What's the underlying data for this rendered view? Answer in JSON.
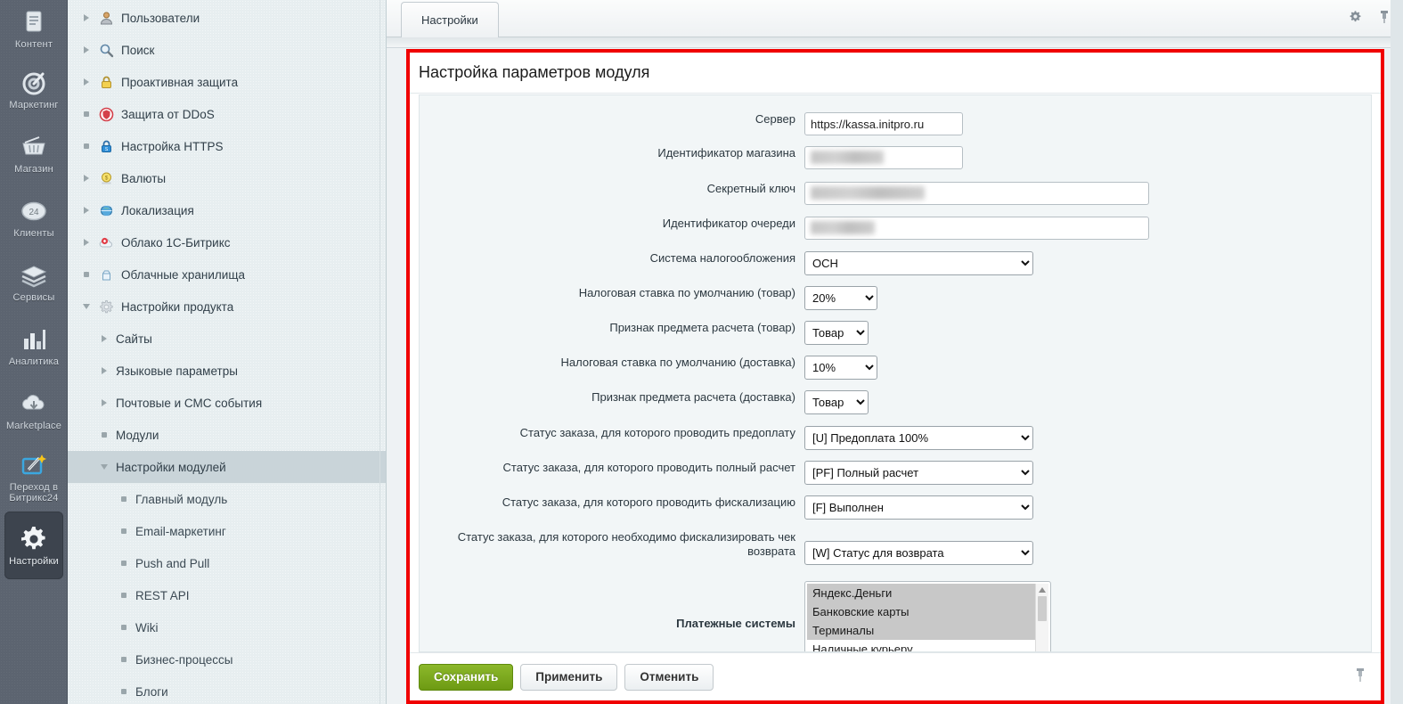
{
  "left_nav": {
    "items": [
      {
        "label": "Контент",
        "icon": "document-icon",
        "active": false
      },
      {
        "label": "Маркетинг",
        "icon": "target-icon",
        "active": false
      },
      {
        "label": "Магазин",
        "icon": "basket-icon",
        "active": false
      },
      {
        "label": "Клиенты",
        "icon": "badge-24-icon",
        "active": false
      },
      {
        "label": "Сервисы",
        "icon": "layers-icon",
        "active": false
      },
      {
        "label": "Аналитика",
        "icon": "bar-chart-icon",
        "active": false
      },
      {
        "label": "Marketplace",
        "icon": "cloud-download-icon",
        "active": false
      },
      {
        "label": "Переход в Битрикс24",
        "icon": "magic-wand-icon",
        "active": false
      },
      {
        "label": "Настройки",
        "icon": "gear-icon",
        "active": true
      }
    ]
  },
  "tree": {
    "items": [
      {
        "label": "Пользователи",
        "twisty": "right",
        "icon": "user-icon",
        "level": 1,
        "selected": false
      },
      {
        "label": "Поиск",
        "twisty": "right",
        "icon": "search-icon",
        "level": 1,
        "selected": false
      },
      {
        "label": "Проактивная защита",
        "twisty": "right",
        "icon": "lock-icon",
        "level": 1,
        "selected": false
      },
      {
        "label": "Защита от DDoS",
        "twisty": "dot",
        "icon": "shield-icon",
        "level": 1,
        "selected": false
      },
      {
        "label": "Настройка HTTPS",
        "twisty": "dot",
        "icon": "https-lock-icon",
        "level": 1,
        "selected": false
      },
      {
        "label": "Валюты",
        "twisty": "right",
        "icon": "coin-icon",
        "level": 1,
        "selected": false
      },
      {
        "label": "Локализация",
        "twisty": "right",
        "icon": "globe-icon",
        "level": 1,
        "selected": false
      },
      {
        "label": "Облако 1С-Битрикс",
        "twisty": "right",
        "icon": "cloud-bitrix-icon",
        "level": 1,
        "selected": false
      },
      {
        "label": "Облачные хранилища",
        "twisty": "dot",
        "icon": "cloud-storage-icon",
        "level": 1,
        "selected": false
      },
      {
        "label": "Настройки продукта",
        "twisty": "down",
        "icon": "gear-icon",
        "level": 1,
        "selected": false
      },
      {
        "label": "Сайты",
        "twisty": "right",
        "icon": "none",
        "level": 2,
        "selected": false
      },
      {
        "label": "Языковые параметры",
        "twisty": "right",
        "icon": "none",
        "level": 2,
        "selected": false
      },
      {
        "label": "Почтовые и СМС события",
        "twisty": "right",
        "icon": "none",
        "level": 2,
        "selected": false
      },
      {
        "label": "Модули",
        "twisty": "dot",
        "icon": "none",
        "level": 2,
        "selected": false
      },
      {
        "label": "Настройки модулей",
        "twisty": "down",
        "icon": "none",
        "level": 2,
        "selected": true
      },
      {
        "label": "Главный модуль",
        "twisty": "dot",
        "icon": "none",
        "level": 3,
        "selected": false
      },
      {
        "label": "Email-маркетинг",
        "twisty": "dot",
        "icon": "none",
        "level": 3,
        "selected": false
      },
      {
        "label": "Push and Pull",
        "twisty": "dot",
        "icon": "none",
        "level": 3,
        "selected": false
      },
      {
        "label": "REST API",
        "twisty": "dot",
        "icon": "none",
        "level": 3,
        "selected": false
      },
      {
        "label": "Wiki",
        "twisty": "dot",
        "icon": "none",
        "level": 3,
        "selected": false
      },
      {
        "label": "Бизнес-процессы",
        "twisty": "dot",
        "icon": "none",
        "level": 3,
        "selected": false
      },
      {
        "label": "Блоги",
        "twisty": "dot",
        "icon": "none",
        "level": 3,
        "selected": false
      }
    ]
  },
  "topbar": {
    "tab_label": "Настройки",
    "gear_icon": "gear-icon",
    "pin_icon": "pin-icon"
  },
  "form": {
    "title": "Настройка параметров модуля",
    "fields": {
      "server": {
        "label": "Сервер",
        "value": "https://kassa.initpro.ru"
      },
      "shop_id": {
        "label": "Идентификатор магазина",
        "value": "",
        "redacted": true
      },
      "secret_key": {
        "label": "Секретный ключ",
        "value": "",
        "redacted": true
      },
      "queue_id": {
        "label": "Идентификатор очереди",
        "value": "",
        "redacted": true
      },
      "tax_system": {
        "label": "Система налогообложения",
        "value": "ОСН"
      },
      "vat_goods": {
        "label": "Налоговая ставка по умолчанию (товар)",
        "value": "20%"
      },
      "subject_goods": {
        "label": "Признак предмета расчета (товар)",
        "value": "Товар"
      },
      "vat_delivery": {
        "label": "Налоговая ставка по умолчанию (доставка)",
        "value": "10%"
      },
      "subject_delivery": {
        "label": "Признак предмета расчета (доставка)",
        "value": "Товар"
      },
      "status_prepay": {
        "label": "Статус заказа, для которого проводить предоплату",
        "value": "[U] Предоплата 100%"
      },
      "status_full": {
        "label": "Статус заказа, для которого проводить полный расчет",
        "value": "[PF] Полный расчет"
      },
      "status_fiscal": {
        "label": "Статус заказа, для которого проводить фискализацию",
        "value": "[F] Выполнен"
      },
      "status_refund": {
        "label": "Статус заказа, для которого необходимо фискализировать чек возврата",
        "value": "[W] Статус для возврата"
      },
      "payment_systems": {
        "label": "Платежные системы",
        "options": [
          {
            "label": "Яндекс.Деньги",
            "selected": true
          },
          {
            "label": "Банковские карты",
            "selected": true
          },
          {
            "label": "Терминалы",
            "selected": true
          },
          {
            "label": "Наличные курьеру",
            "selected": false
          }
        ]
      }
    }
  },
  "footer": {
    "save_label": "Сохранить",
    "apply_label": "Применить",
    "cancel_label": "Отменить",
    "pin_icon": "pin-icon"
  },
  "colors": {
    "highlight_border": "#f00000",
    "primary_button": "#7ca81f",
    "nav_background": "#5c6470",
    "tree_background": "#e7eef0",
    "selected_row": "#c9d4d9"
  }
}
